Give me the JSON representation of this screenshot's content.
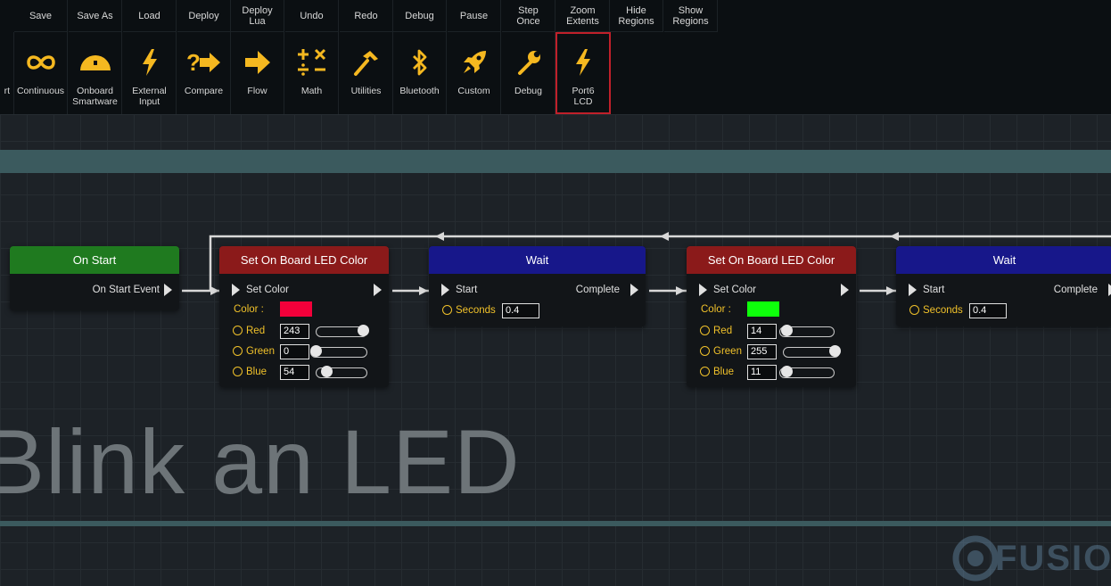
{
  "topbar": {
    "buttons": [
      "Save",
      "Save As",
      "Load",
      "Deploy",
      "Deploy\nLua",
      "Undo",
      "Redo",
      "Debug",
      "Pause",
      "Step\nOnce",
      "Zoom\nExtents",
      "Hide\nRegions",
      "Show\nRegions"
    ]
  },
  "toolbar": {
    "partial_label": "rt",
    "tools": [
      {
        "label": "Continuous",
        "icon": "infinity-icon"
      },
      {
        "label": "Onboard\nSmartware",
        "icon": "dome-icon"
      },
      {
        "label": "External\nInput",
        "icon": "lightning-icon"
      },
      {
        "label": "Compare",
        "icon": "question-arrow-icon"
      },
      {
        "label": "Flow",
        "icon": "arrow-right-icon"
      },
      {
        "label": "Math",
        "icon": "math-operators-icon"
      },
      {
        "label": "Utilities",
        "icon": "hammer-icon"
      },
      {
        "label": "Bluetooth",
        "icon": "bluetooth-icon"
      },
      {
        "label": "Custom",
        "icon": "rocket-icon"
      },
      {
        "label": "Debug",
        "icon": "wrench-icon"
      },
      {
        "label": "Port6\nLCD",
        "icon": "lightning-icon",
        "selected": true
      }
    ],
    "icon_color": "#f5b820"
  },
  "region": {
    "title": "Blink an LED",
    "bar_color": "#3b5a5e"
  },
  "nodes": {
    "on_start": {
      "title": "On Start",
      "output": "On Start Event",
      "header_color": "#1f7a1f"
    },
    "set_led_1": {
      "title": "Set On Board LED Color",
      "input": "Set Color",
      "color_label": "Color :",
      "swatch_color": "#f3003a",
      "red_label": "Red",
      "red": "243",
      "green_label": "Green",
      "green": "0",
      "blue_label": "Blue",
      "blue": "54",
      "header_color": "#8b1a1a"
    },
    "wait_1": {
      "title": "Wait",
      "input": "Start",
      "output": "Complete",
      "seconds_label": "Seconds",
      "seconds": "0.4",
      "header_color": "#17178a"
    },
    "set_led_2": {
      "title": "Set On Board LED Color",
      "input": "Set Color",
      "color_label": "Color :",
      "swatch_color": "#0eff0b",
      "red_label": "Red",
      "red": "14",
      "green_label": "Green",
      "green": "255",
      "blue_label": "Blue",
      "blue": "11",
      "header_color": "#8b1a1a"
    },
    "wait_2": {
      "title": "Wait",
      "input": "Start",
      "output": "Complete",
      "seconds_label": "Seconds",
      "seconds": "0.4",
      "header_color": "#17178a"
    }
  },
  "watermark": {
    "text": "FUSIO"
  }
}
